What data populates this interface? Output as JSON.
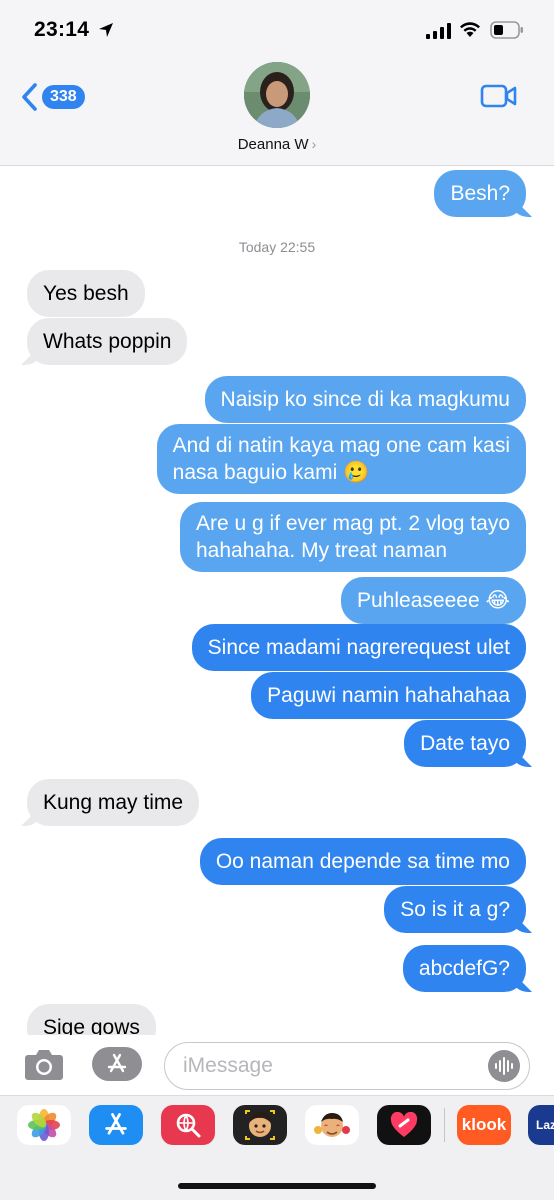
{
  "status_bar": {
    "time": "23:14",
    "icons": [
      "location-arrow-icon",
      "cellular-signal-icon",
      "wifi-icon",
      "battery-icon"
    ]
  },
  "header": {
    "back_count": "338",
    "contact_name": "Deanna W",
    "name_chevron": "›",
    "icons": [
      "back-chevron-icon",
      "video-camera-icon"
    ]
  },
  "messages": {
    "timestamp": "Today 22:55",
    "items": [
      {
        "side": "sent",
        "text": "Besh?"
      },
      {
        "side": "received",
        "text": "Yes besh"
      },
      {
        "side": "received",
        "text": "Whats poppin"
      },
      {
        "side": "sent",
        "text": "Naisip ko since di ka magkumu"
      },
      {
        "side": "sent",
        "line1": "And di natin kaya mag one cam kasi",
        "line2": "nasa baguio kami 🥲"
      },
      {
        "side": "sent",
        "line1": "Are u g if ever mag pt. 2 vlog tayo",
        "line2": "hahahaha. My treat naman"
      },
      {
        "side": "sent",
        "text": "Puhleaseeee 😂"
      },
      {
        "side": "sent",
        "text": "Since madami nagrerequest ulet"
      },
      {
        "side": "sent",
        "text": "Paguwi namin hahahahaa"
      },
      {
        "side": "sent",
        "text": "Date tayo"
      },
      {
        "side": "received",
        "text": "Kung may time"
      },
      {
        "side": "sent",
        "text": "Oo naman depende sa time mo"
      },
      {
        "side": "sent",
        "text": "So is it a g?"
      },
      {
        "side": "sent",
        "text": "abcdefG?"
      },
      {
        "side": "received",
        "text": "Sige gows"
      }
    ]
  },
  "input": {
    "placeholder": "iMessage",
    "value": "",
    "icons": [
      "camera-icon",
      "app-store-icon",
      "audio-waveform-icon"
    ]
  },
  "drawer": {
    "apps": [
      "photos-app-icon",
      "app-store-app-icon",
      "search-globe-app-icon",
      "memoji-app-icon",
      "memoji-stickers-app-icon",
      "heart-digital-touch-app-icon",
      "klook-app-icon",
      "lazada-app-icon"
    ],
    "klook_label": "klook",
    "lazada_label": "Laz"
  },
  "colors": {
    "sent_bubble": "#2f84f0",
    "sent_bubble_light": "#59a5f0",
    "received_bubble": "#e9e9eb",
    "header_bg": "#f5f5f7",
    "accent": "#2f84f0"
  }
}
